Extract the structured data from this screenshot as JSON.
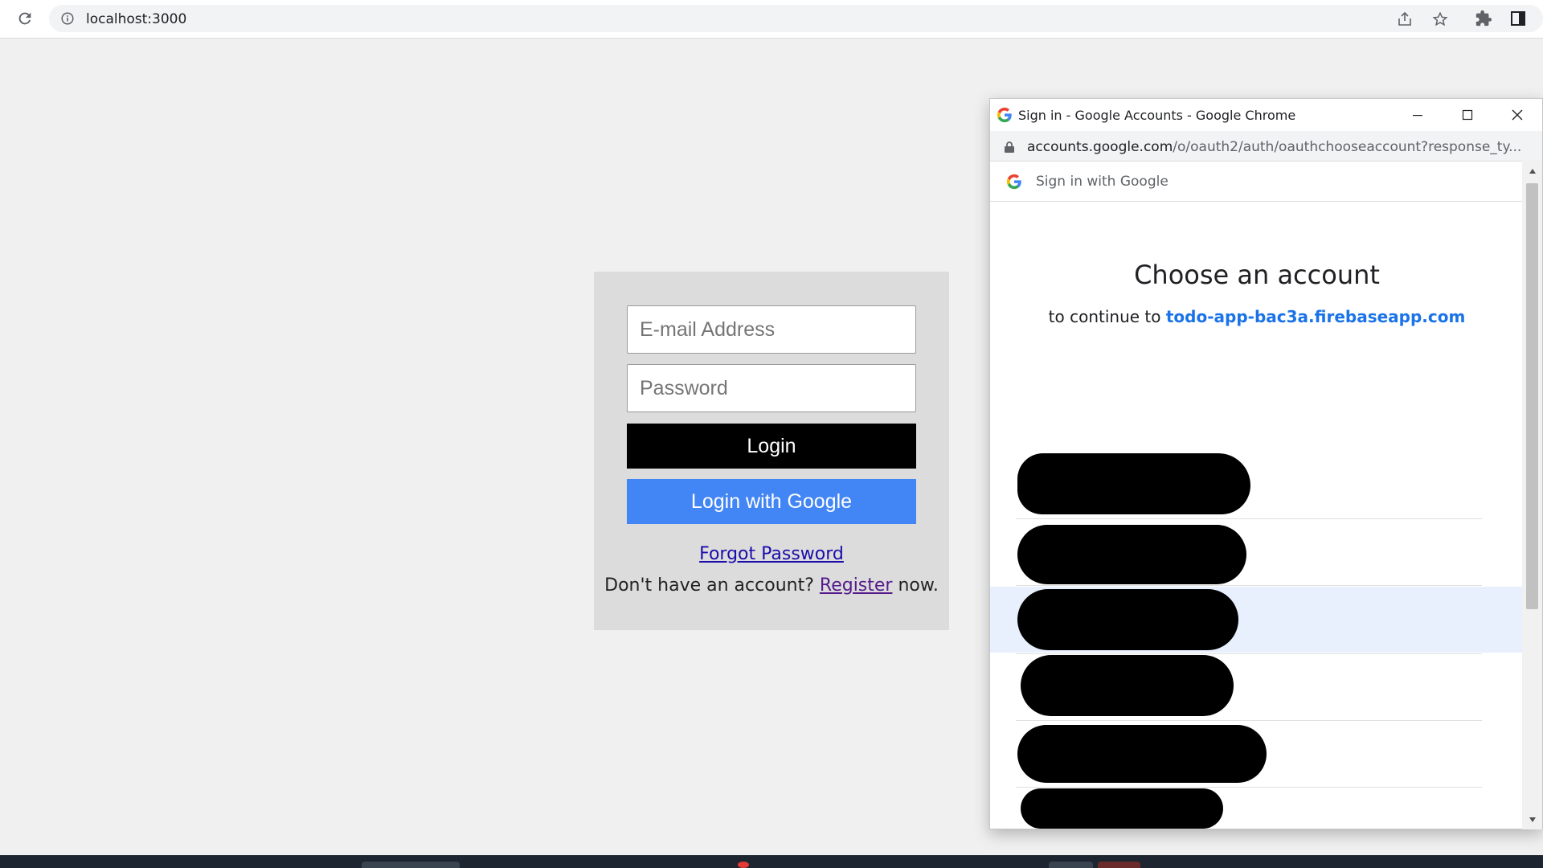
{
  "browser": {
    "url": "localhost:3000",
    "icons": [
      "reload-icon",
      "info-icon",
      "share-icon",
      "star-icon",
      "extensions-icon",
      "side-panel-icon"
    ]
  },
  "login": {
    "email_placeholder": "E-mail Address",
    "password_placeholder": "Password",
    "login_label": "Login",
    "google_label": "Login with Google",
    "forgot_label": "Forgot Password",
    "register_prefix": "Don't have an account?",
    "register_link": "Register",
    "register_suffix": "now.",
    "colors": {
      "card_bg": "#dcdcdc",
      "login_btn": "#000000",
      "google_btn": "#4285f4"
    }
  },
  "popup": {
    "window_title": "Sign in - Google Accounts - Google Chrome",
    "url_domain": "accounts.google.com",
    "url_path": "/o/oauth2/auth/oauthchooseaccount?response_ty...",
    "signin_header": "Sign in with Google",
    "choose_title": "Choose an account",
    "continue_prefix": "to continue to",
    "continue_app": "todo-app-bac3a.firebaseapp.com",
    "accounts_count": 7,
    "selected_account_index": 2,
    "accent": "#1a73e8"
  }
}
